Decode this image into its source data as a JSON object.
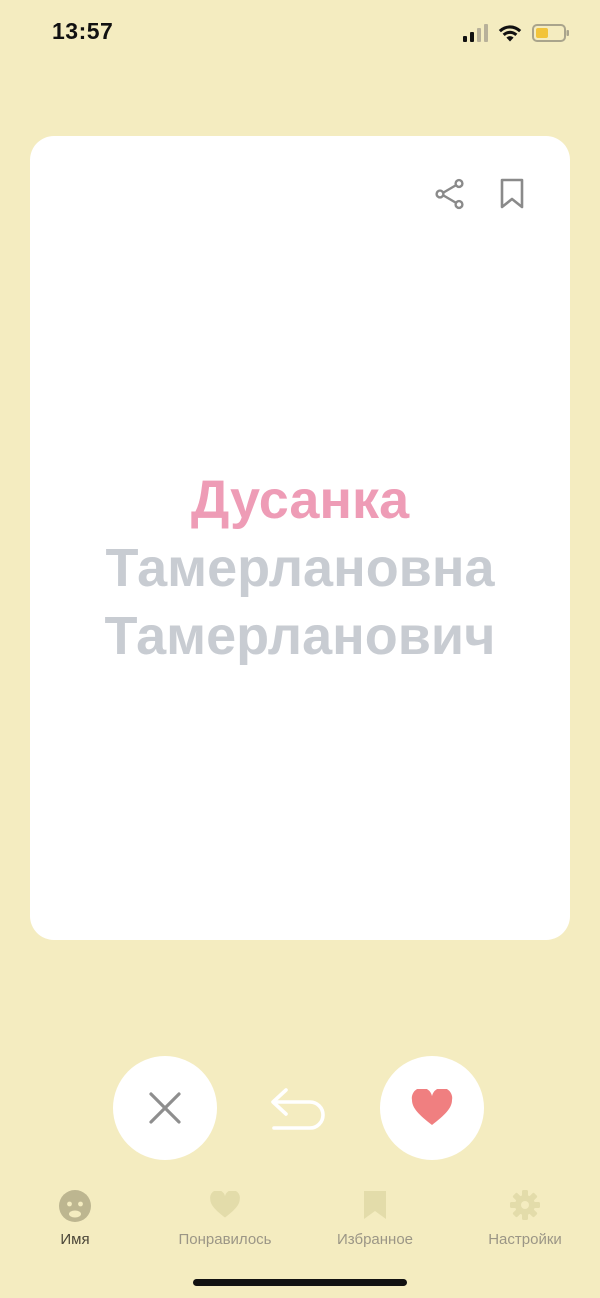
{
  "status_bar": {
    "time": "13:57"
  },
  "card": {
    "first_name": "Дусанка",
    "patronymic": "Тамерлановна",
    "surname": "Тамерланович",
    "share_icon": "share-icon",
    "bookmark_icon": "bookmark-icon"
  },
  "actions": {
    "dislike_icon": "close-icon",
    "undo_icon": "undo-icon",
    "like_icon": "heart-icon"
  },
  "tabs": [
    {
      "label": "Имя",
      "icon": "baby-face-icon",
      "active": true
    },
    {
      "label": "Понравилось",
      "icon": "heart-icon",
      "active": false
    },
    {
      "label": "Избранное",
      "icon": "bookmark-icon",
      "active": false
    },
    {
      "label": "Настройки",
      "icon": "gear-icon",
      "active": false
    }
  ],
  "colors": {
    "background": "#f4ecc0",
    "card": "#ffffff",
    "first_name": "#ee9cb6",
    "secondary_name": "#c8ccd2",
    "like": "#f07f80",
    "icon_inactive": "#e3dcaa",
    "icon_active": "#bdb690"
  }
}
